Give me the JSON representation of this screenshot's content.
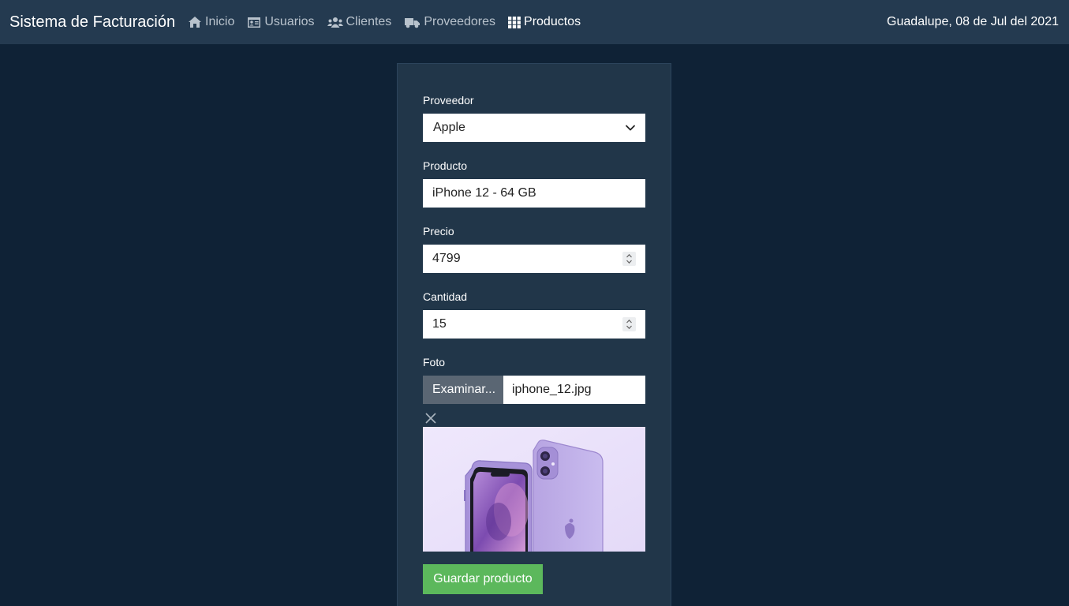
{
  "navbar": {
    "brand": "Sistema de Facturación",
    "items": [
      {
        "label": "Inicio",
        "icon": "home-icon"
      },
      {
        "label": "Usuarios",
        "icon": "id-card-icon"
      },
      {
        "label": "Clientes",
        "icon": "users-icon"
      },
      {
        "label": "Proveedores",
        "icon": "truck-icon"
      },
      {
        "label": "Productos",
        "icon": "grid-icon",
        "active": true
      }
    ],
    "date": "Guadalupe, 08 de Jul del 2021"
  },
  "form": {
    "proveedor": {
      "label": "Proveedor",
      "value": "Apple"
    },
    "producto": {
      "label": "Producto",
      "value": "iPhone 12 - 64 GB"
    },
    "precio": {
      "label": "Precio",
      "value": "4799"
    },
    "cantidad": {
      "label": "Cantidad",
      "value": "15"
    },
    "foto": {
      "label": "Foto",
      "button": "Examinar...",
      "filename": "iphone_12.jpg"
    },
    "save_label": "Guardar producto"
  },
  "colors": {
    "background": "#0f2236",
    "navbar": "#243a50",
    "card": "#213649",
    "save_button": "#5cb85c",
    "file_button": "#5a6673"
  }
}
